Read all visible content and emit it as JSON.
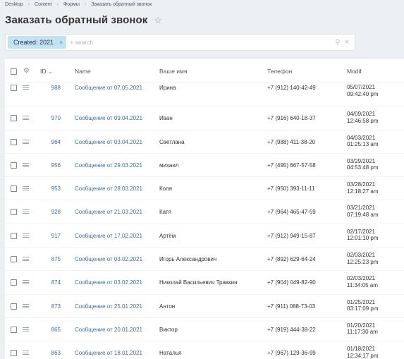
{
  "breadcrumbs": [
    "Desktop",
    "Content",
    "Формы",
    "Заказать обратный звонок"
  ],
  "page": {
    "title": "Заказать обратный звонок"
  },
  "search": {
    "chip_label": "Created: 2021",
    "placeholder": "+ search"
  },
  "columns": {
    "id": "ID",
    "name": "Name",
    "person": "Ваше имя",
    "phone": "Телефон",
    "modified": "Modif"
  },
  "rows": [
    {
      "id": "988",
      "name": "Сообщение от 07.05.2021",
      "person": "Ирина",
      "phone": "+7 (912) 140-42-49",
      "date": "05/07/2021",
      "time": "09:42:40 pm"
    },
    {
      "id": "970",
      "name": "Сообщение от 09.04.2021",
      "person": "Иван",
      "phone": "+7 (916) 640-18-37",
      "date": "04/09/2021",
      "time": "12:46:58 pm"
    },
    {
      "id": "964",
      "name": "Сообщение от 03.04.2021",
      "person": "Светлана",
      "phone": "+7 (988) 411-38-20",
      "date": "04/03/2021",
      "time": "01:25:13 am"
    },
    {
      "id": "956",
      "name": "Сообщение от 29.03.2021",
      "person": "михаил",
      "phone": "+7 (495) 667-57-58",
      "date": "03/29/2021",
      "time": "04:53:48 pm"
    },
    {
      "id": "953",
      "name": "Сообщение от 28.03.2021",
      "person": "Коля",
      "phone": "+7 (950) 393-11-11",
      "date": "03/28/2021",
      "time": "12:18:27 am"
    },
    {
      "id": "928",
      "name": "Сообщение от 21.03.2021",
      "person": "Катя",
      "phone": "+7 (964) 465-47-59",
      "date": "03/21/2021",
      "time": "07:19:48 am"
    },
    {
      "id": "917",
      "name": "Сообщение от 17.02.2021",
      "person": "Артём",
      "phone": "+7 (912) 949-15-87",
      "date": "02/17/2021",
      "time": "12:01:10 pm"
    },
    {
      "id": "875",
      "name": "Сообщение от 03.02.2021",
      "person": "Игорь Александрович",
      "phone": "+7 (892) 629-64-24",
      "date": "02/03/2021",
      "time": "12:25:23 pm"
    },
    {
      "id": "874",
      "name": "Сообщение от 03.02.2021",
      "person": "Николай Васильевич Травкин",
      "phone": "+7 (904) 049-82-90",
      "date": "02/03/2021",
      "time": "11:34:05 am"
    },
    {
      "id": "873",
      "name": "Сообщение от 25.01.2021",
      "person": "Антон",
      "phone": "+7 (911) 088-73-03",
      "date": "01/25/2021",
      "time": "03:17:09 pm"
    },
    {
      "id": "865",
      "name": "Сообщение от 20.01.2021",
      "person": "Виктор",
      "phone": "+7 (919) 444-38-22",
      "date": "01/20/2021",
      "time": "11:17:30 am"
    },
    {
      "id": "863",
      "name": "Сообщение от 18.01.2021",
      "person": "Наталья",
      "phone": "+7 (967) 129-36-99",
      "date": "01/18/2021",
      "time": "12:34:17 pm"
    }
  ]
}
